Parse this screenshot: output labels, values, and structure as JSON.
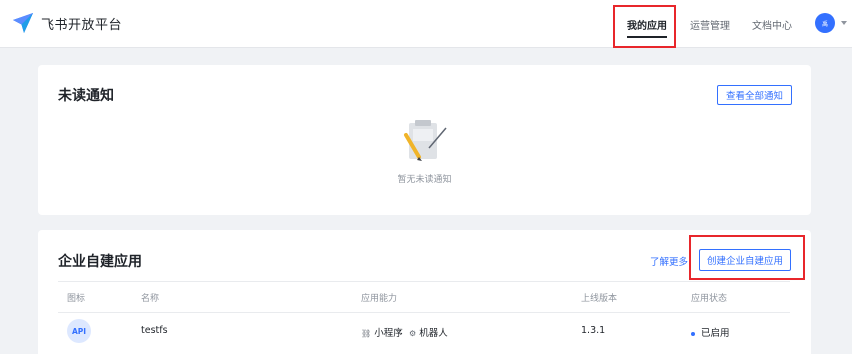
{
  "header": {
    "logo_text": "飞书开放平台",
    "nav": [
      {
        "label": "我的应用"
      },
      {
        "label": "运营管理"
      },
      {
        "label": "文档中心"
      }
    ],
    "avatar_text": "禹"
  },
  "notifications": {
    "title": "未读通知",
    "view_all_label": "查看全部通知",
    "empty_text": "暂无未读通知"
  },
  "apps": {
    "title": "企业自建应用",
    "learn_more": "了解更多",
    "create_label": "创建企业自建应用",
    "columns": [
      "图标",
      "名称",
      "应用能力",
      "上线版本",
      "应用状态"
    ],
    "rows": [
      {
        "icon_text": "API",
        "name": "testfs",
        "abilities": [
          "小程序",
          "机器人"
        ],
        "version": "1.3.1",
        "status": "已启用"
      }
    ]
  },
  "colors": {
    "brand_blue": "#3370ff",
    "highlight_red": "#e8262b",
    "page_bg": "#f0f2f5"
  }
}
